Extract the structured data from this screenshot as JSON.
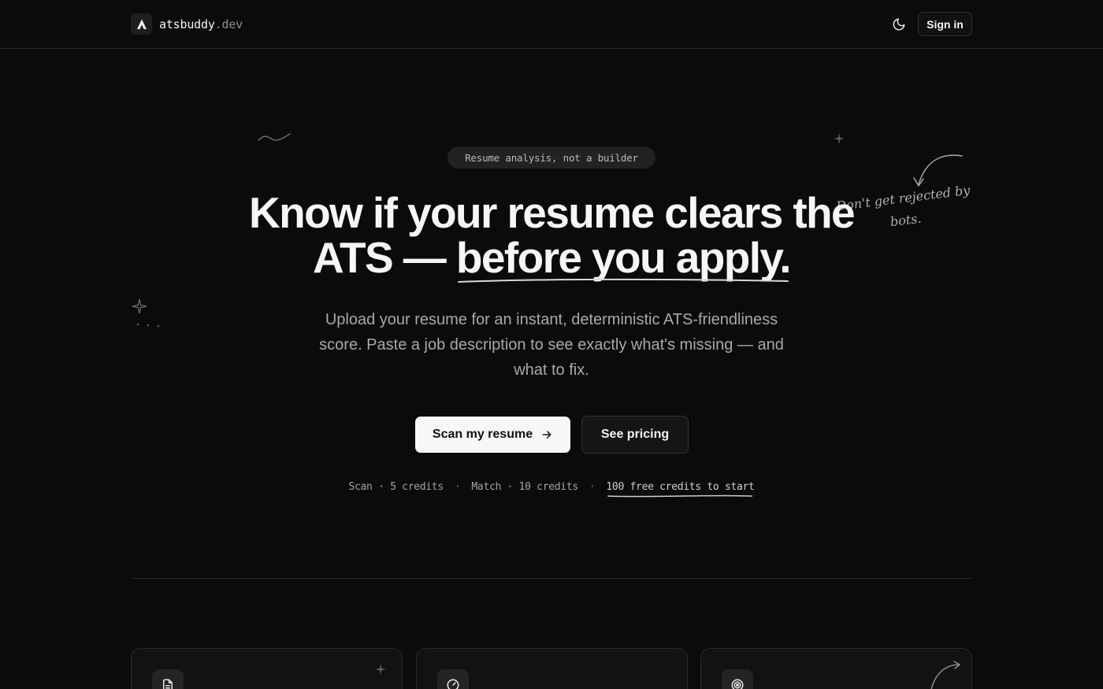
{
  "header": {
    "brand_name": "atsbuddy",
    "brand_tld": ".dev",
    "theme_toggle_icon": "moon-icon",
    "signin_label": "Sign in"
  },
  "hero": {
    "badge": "Resume analysis, not a builder",
    "headline_part1": "Know if your resume clears the ATS —",
    "headline_highlight": "before you apply.",
    "subtitle": "Upload your resume for an instant, deterministic ATS-friendliness score. Paste a job description to see exactly what's missing — and what to fix.",
    "primary_cta": "Scan my resume",
    "primary_cta_icon": "arrow-right-icon",
    "secondary_cta": "See pricing",
    "credits": {
      "scan": "Scan · 5 credits",
      "match": "Match · 10 credits",
      "separator": "·",
      "free": "100 free credits to start"
    },
    "note": "Don't get rejected by bots."
  },
  "features": {
    "cards": [
      {
        "icon": "document-icon"
      },
      {
        "icon": "gauge-icon"
      },
      {
        "icon": "target-icon"
      }
    ]
  },
  "colors": {
    "background": "#0b0b0b",
    "text": "#f6f6f6",
    "muted": "#a9a9a9",
    "border": "#2a2a2a"
  }
}
